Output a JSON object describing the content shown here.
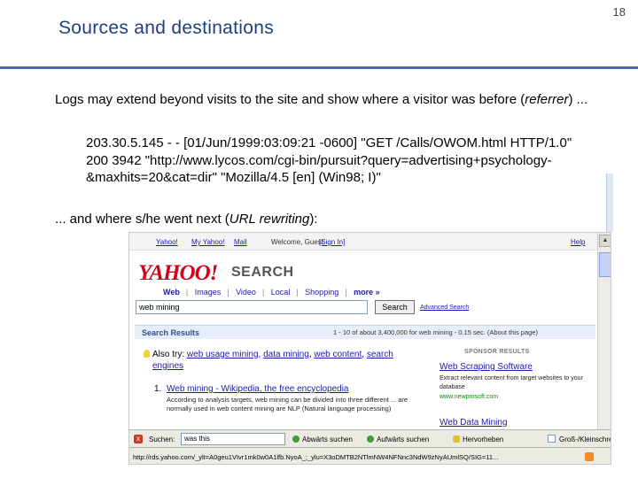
{
  "slide": {
    "title": "Sources and destinations",
    "number": "18"
  },
  "body": {
    "para1_main": "Logs may extend beyond visits to the site and show where a visitor was before (",
    "para1_italic": "referrer",
    "para1_end": ") ...",
    "log_line": "203.30.5.145 - - [01/Jun/1999:03:09:21 -0600] \"GET /Calls/OWOM.html HTTP/1.0\" 200 3942 \"http://www.lycos.com/cgi-bin/pursuit?query=advertising+psychology-&maxhits=20&cat=dir\" \"Mozilla/4.5 [en] (Win98; I)\"",
    "para3_main": "... and where s/he went next (",
    "para3_italic": "URL rewriting",
    "para3_end": "):"
  },
  "browser": {
    "toplinks": {
      "yahoo": "Yahoo!",
      "my_yahoo": "My Yahoo!",
      "mail": "Mail",
      "welcome": "Welcome, Guest",
      "sign_in": "[Sign In]",
      "help": "Help"
    },
    "logo": "YAHOO!",
    "logo_sub": "SEARCH",
    "tabs": {
      "web": "Web",
      "images": "Images",
      "video": "Video",
      "local": "Local",
      "shopping": "Shopping",
      "more": "more »"
    },
    "search_value": "web mining",
    "search_button": "Search",
    "advanced_search": "Advanced Search",
    "results_title": "Search Results",
    "results_count": "1 - 10 of about 3,400,000 for web mining - 0.15 sec. (About this page)",
    "suggest": {
      "label": "Also try:",
      "t1": "web usage mining",
      "t2": "data mining",
      "t3": "web content",
      "t4": "search engines"
    },
    "sponsor": {
      "title": "SPONSOR RESULTS",
      "ad1_title": "Web Scraping Software",
      "ad1_desc": "Extract relevant content from target websites to your database",
      "ad1_url": "www.newprosoft.com",
      "ad2_title": "Web Data Mining"
    },
    "result1": {
      "num": "1.",
      "title": "Web mining - Wikipedia, the free encyclopedia",
      "snippet": "According to analysis targets, web mining can be divided into three different ... are normally used in web content mining are NLP (Natural language processing)"
    },
    "findbar": {
      "close": "x",
      "label": "Suchen:",
      "value": "was this",
      "down": "Abwärts suchen",
      "up": "Aufwärts suchen",
      "highlight": "Hervorheben",
      "case": "Groß-/Kleinschreibung"
    },
    "status_url": "http://rds.yahoo.com/_ylt=A0geu1VIvr1mk0w0A1lfb.NyoA_;_ylu=X3oDMTB2NTlmNW4NFNnc3NdW9zNyAUmlSQ/SIG=11..."
  }
}
